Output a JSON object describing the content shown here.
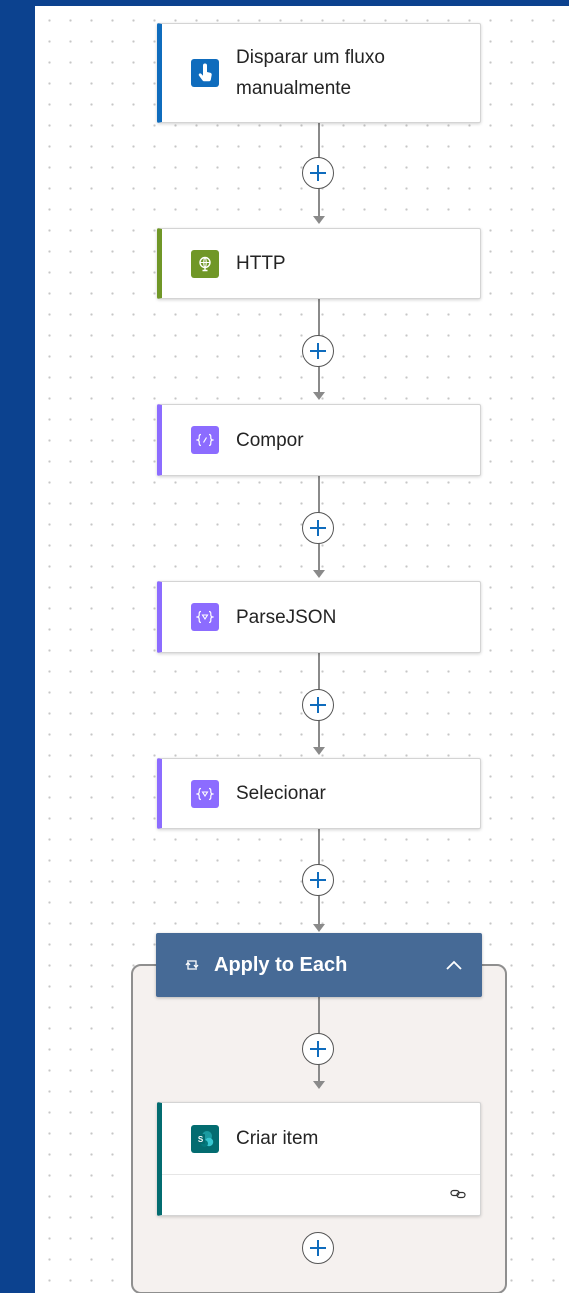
{
  "flow": {
    "steps": [
      {
        "label_line1": "Disparar um fluxo",
        "label_line2": "manualmente",
        "icon": "manual-trigger-icon",
        "accent": "#0f6cbd",
        "icon_bg": "#0f6cbd"
      },
      {
        "label": "HTTP",
        "icon": "http-globe-icon",
        "accent": "#709727",
        "icon_bg": "#709727"
      },
      {
        "label": "Compor",
        "icon": "compose-braces-icon",
        "accent": "#8c6cff",
        "icon_bg": "#8c6cff"
      },
      {
        "label": "ParseJSON",
        "icon": "data-operation-icon",
        "accent": "#8c6cff",
        "icon_bg": "#8c6cff"
      },
      {
        "label": "Selecionar",
        "icon": "data-operation-icon",
        "accent": "#8c6cff",
        "icon_bg": "#8c6cff"
      }
    ],
    "loop": {
      "title": "Apply to Each",
      "icon": "loop-icon",
      "color": "#466a96",
      "collapse_icon": "chevron-up-icon",
      "inner_step": {
        "label": "Criar item",
        "icon": "sharepoint-icon",
        "accent": "#036c70",
        "icon_bg": "#036c70",
        "footer_icon": "link-icon"
      }
    },
    "add_button_icon": "plus-icon"
  }
}
